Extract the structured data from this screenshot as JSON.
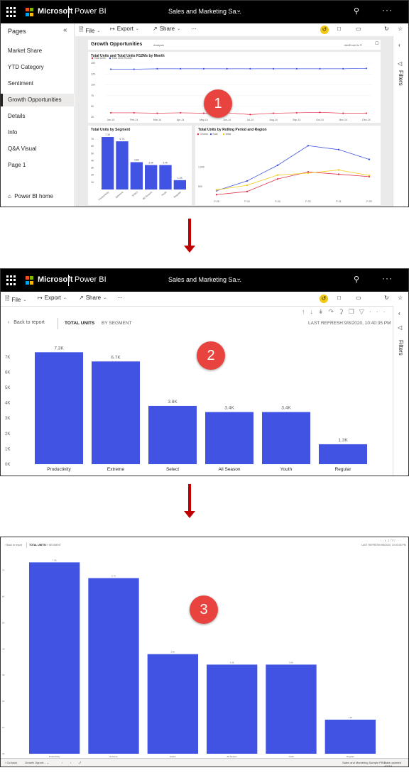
{
  "app": {
    "brand": "Microsoft",
    "product": "Power BI",
    "report_title": "Sales and Marketing Sa...",
    "accent_color": "#f2c811",
    "bar_color": "#4053e3"
  },
  "commands": {
    "file": "File",
    "export": "Export",
    "share": "Share"
  },
  "pages_pane": {
    "title": "Pages",
    "items": [
      {
        "label": "Market Share"
      },
      {
        "label": "YTD Category"
      },
      {
        "label": "Sentiment"
      },
      {
        "label": "Growth Opportunities"
      },
      {
        "label": "Details"
      },
      {
        "label": "Info"
      },
      {
        "label": "Q&A Visual"
      },
      {
        "label": "Page 1"
      }
    ],
    "active_index": 3,
    "home_label": "Power BI home"
  },
  "filters_label": "Filters",
  "report_page": {
    "title": "Growth Opportunities",
    "subtitle": "Analysis",
    "tag": "obviEnce llc ©",
    "line_card": {
      "title": "Total Units and Total Units R12Ms by Month",
      "legend": [
        "Total Units",
        "Total Units R12Ms"
      ],
      "y_ticks": [
        "150",
        "125",
        "100",
        "75",
        "50",
        "25"
      ],
      "x_ticks": [
        "Jan-14",
        "Feb-14",
        "Mar-14",
        "Apr-14",
        "May-14",
        "Jun-14",
        "Jul-14",
        "Aug-14",
        "Sep-14",
        "Oct-14",
        "Nov-14",
        "Dec-14"
      ]
    },
    "bar_card": {
      "title": "Total Units by Segment",
      "labels": [
        "7.3K",
        "6.7K",
        "3.8K",
        "3.4K",
        "3.4K",
        "1.3K"
      ]
    },
    "region_card": {
      "title": "Total Units by Rolling Period and Region",
      "legend": [
        "Central",
        "East",
        "West"
      ],
      "y_ticks": [
        "1,000",
        "500"
      ],
      "x_ticks": [
        "P-05",
        "P-04",
        "P-03",
        "P-02",
        "P-01",
        "P-00"
      ]
    }
  },
  "focus": {
    "back_label": "Back to report",
    "tab_total": "TOTAL UNITS",
    "tab_segment": "BY SEGMENT",
    "last_refresh": "LAST REFRESH:9/8/2020, 10:40:35 PM",
    "value_labels": [
      "7.3K",
      "6.7K",
      "3.8K",
      "3.4K",
      "3.4K",
      "1.3K"
    ],
    "y_ticks": [
      "7K",
      "6K",
      "5K",
      "4K",
      "3K",
      "2K",
      "1K",
      "0K"
    ]
  },
  "fullscreen": {
    "status_back": "Go back",
    "status_page": "Growth Opport...",
    "status_right": "Sales and Marketing Sample PBIX",
    "status_updated": "Data updated 4/1/18"
  },
  "steps": [
    "1",
    "2",
    "3"
  ],
  "chart_data": [
    {
      "type": "bar",
      "title": "Total Units by Segment",
      "categories": [
        "Productivity",
        "Extreme",
        "Select",
        "All Season",
        "Youth",
        "Regular"
      ],
      "values": [
        7300,
        6700,
        3800,
        3400,
        3400,
        1300
      ],
      "ylim": [
        0,
        7500
      ]
    },
    {
      "type": "line",
      "title": "Total Units and Total Units R12Ms by Month",
      "categories": [
        "Jan-14",
        "Feb-14",
        "Mar-14",
        "Apr-14",
        "May-14",
        "Jun-14",
        "Jul-14",
        "Aug-14",
        "Sep-14",
        "Oct-14",
        "Nov-14",
        "Dec-14"
      ],
      "series": [
        {
          "name": "Total Units",
          "values": [
            35,
            35,
            34,
            35,
            34,
            35,
            31,
            34,
            35,
            36,
            34,
            34
          ]
        },
        {
          "name": "Total Units R12Ms",
          "values": [
            136,
            136,
            137,
            137,
            137,
            137,
            137,
            137,
            137,
            137,
            137,
            138
          ]
        }
      ],
      "ylim": [
        25,
        150
      ]
    },
    {
      "type": "line",
      "title": "Total Units by Rolling Period and Region",
      "categories": [
        "P-05",
        "P-04",
        "P-03",
        "P-02",
        "P-01",
        "P-00"
      ],
      "series": [
        {
          "name": "Central",
          "values": [
            300,
            380,
            700,
            880,
            820,
            760
          ]
        },
        {
          "name": "East",
          "values": [
            400,
            650,
            1050,
            1550,
            1450,
            1200
          ]
        },
        {
          "name": "West",
          "values": [
            420,
            540,
            800,
            850,
            930,
            790
          ]
        }
      ],
      "ylim": [
        250,
        1700
      ]
    }
  ]
}
